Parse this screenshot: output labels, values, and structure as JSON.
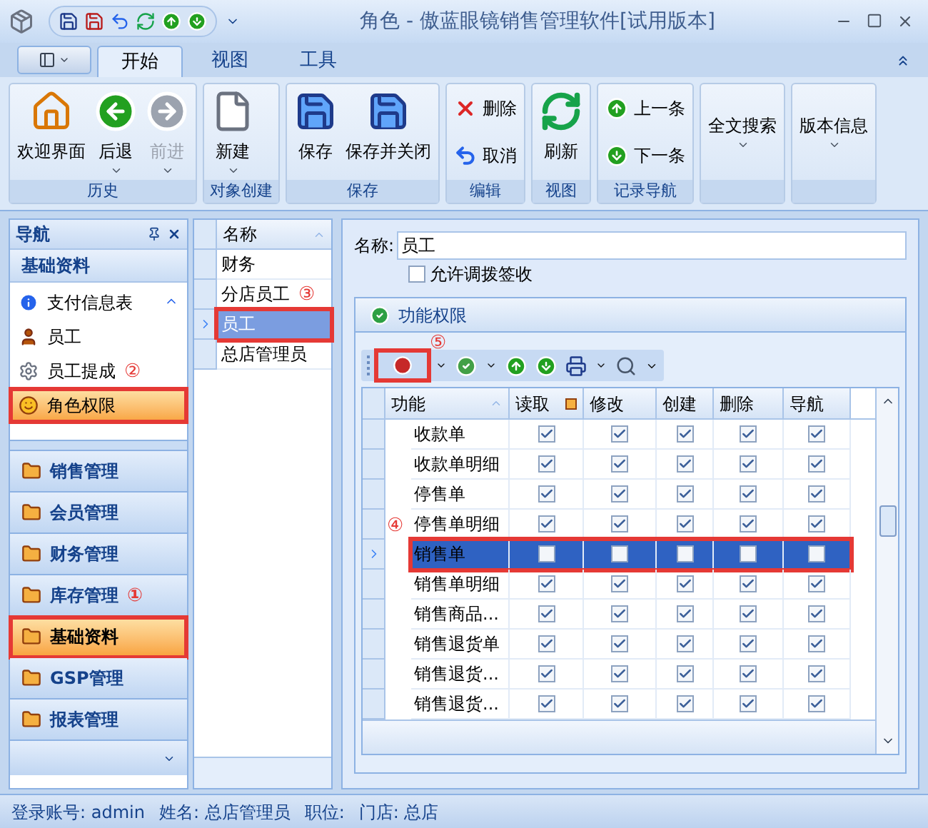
{
  "window": {
    "title": "角色 - 傲蓝眼镜销售管理软件[试用版本]"
  },
  "tabs": [
    {
      "label": "开始",
      "selected": true
    },
    {
      "label": "视图",
      "selected": false
    },
    {
      "label": "工具",
      "selected": false
    }
  ],
  "ribbon": [
    {
      "label": "历史",
      "items": [
        {
          "label": "欢迎界面",
          "kind": "welcome",
          "disabled": false,
          "dropdown": false
        },
        {
          "label": "后退",
          "kind": "back",
          "disabled": false,
          "dropdown": true
        },
        {
          "label": "前进",
          "kind": "forward",
          "disabled": true,
          "dropdown": true
        }
      ]
    },
    {
      "label": "对象创建",
      "items": [
        {
          "label": "新建",
          "kind": "new",
          "disabled": false,
          "dropdown": true
        }
      ]
    },
    {
      "label": "保存",
      "items": [
        {
          "label": "保存",
          "kind": "save",
          "disabled": false,
          "dropdown": false
        },
        {
          "label": "保存并关闭",
          "kind": "saveclose",
          "disabled": false,
          "dropdown": false
        }
      ]
    },
    {
      "label": "编辑",
      "items": [
        {
          "label": "删除",
          "kind": "delete",
          "disabled": false,
          "dropdown": false
        },
        {
          "label": "取消",
          "kind": "undo",
          "disabled": false,
          "dropdown": false
        }
      ]
    },
    {
      "label": "视图",
      "items": [
        {
          "label": "刷新",
          "kind": "refresh",
          "disabled": false,
          "dropdown": false
        }
      ]
    },
    {
      "label": "记录导航",
      "items": [
        {
          "label": "上一条",
          "kind": "up",
          "disabled": false,
          "dropdown": false
        },
        {
          "label": "下一条",
          "kind": "down",
          "disabled": false,
          "dropdown": false
        }
      ]
    },
    {
      "items": [
        {
          "label": "全文搜索",
          "kind": "text",
          "disabled": false,
          "dropdown": true
        }
      ]
    },
    {
      "items": [
        {
          "label": "版本信息",
          "kind": "text",
          "disabled": false,
          "dropdown": true
        }
      ]
    }
  ],
  "navigation": {
    "title": "导航",
    "section": "基础资料",
    "items": [
      {
        "label": "支付信息表",
        "kind": "info",
        "selected": false,
        "highlighted": false
      },
      {
        "label": "员工",
        "kind": "user",
        "selected": false,
        "highlighted": false
      },
      {
        "label": "员工提成",
        "kind": "gear",
        "selected": false,
        "highlighted": false,
        "annotation": "②"
      },
      {
        "label": "角色权限",
        "kind": "mask",
        "selected": true,
        "highlighted": true
      }
    ],
    "categories": [
      {
        "label": "销售管理",
        "selected": false,
        "highlighted": false
      },
      {
        "label": "会员管理",
        "selected": false,
        "highlighted": false
      },
      {
        "label": "财务管理",
        "selected": false,
        "highlighted": false
      },
      {
        "label": "库存管理",
        "selected": false,
        "highlighted": false,
        "annotation": "①"
      },
      {
        "label": "基础资料",
        "selected": true,
        "highlighted": true
      },
      {
        "label": "GSP管理",
        "selected": false,
        "highlighted": false
      },
      {
        "label": "报表管理",
        "selected": false,
        "highlighted": false
      }
    ]
  },
  "role_list": {
    "column": "名称",
    "rows": [
      {
        "name": "财务",
        "selected": false,
        "highlighted": false
      },
      {
        "name": "分店员工",
        "selected": false,
        "highlighted": false,
        "annotation": "③"
      },
      {
        "name": "员工",
        "selected": true,
        "highlighted": true
      },
      {
        "name": "总店管理员",
        "selected": false,
        "highlighted": false
      }
    ]
  },
  "form": {
    "name_label": "名称:",
    "name_value": "员工",
    "checkbox": {
      "label": "允许调拨签收",
      "checked": false
    }
  },
  "permissions": {
    "title": "功能权限",
    "toolbar_annotation": "⑤",
    "grid_annotation": "④",
    "columns": [
      "功能",
      "读取",
      "修改",
      "创建",
      "删除",
      "导航"
    ],
    "rows": [
      {
        "function": "收款单",
        "selected": false,
        "perms": [
          true,
          true,
          true,
          true,
          true
        ]
      },
      {
        "function": "收款单明细",
        "selected": false,
        "perms": [
          true,
          true,
          true,
          true,
          true
        ]
      },
      {
        "function": "停售单",
        "selected": false,
        "perms": [
          true,
          true,
          true,
          true,
          true
        ]
      },
      {
        "function": "停售单明细",
        "selected": false,
        "perms": [
          true,
          true,
          true,
          true,
          true
        ]
      },
      {
        "function": "销售单",
        "selected": true,
        "perms": [
          false,
          false,
          false,
          false,
          false
        ]
      },
      {
        "function": "销售单明细",
        "selected": false,
        "perms": [
          true,
          true,
          true,
          true,
          true
        ]
      },
      {
        "function": "销售商品...",
        "selected": false,
        "perms": [
          true,
          true,
          true,
          true,
          true
        ]
      },
      {
        "function": "销售退货单",
        "selected": false,
        "perms": [
          true,
          true,
          true,
          true,
          true
        ]
      },
      {
        "function": "销售退货...",
        "selected": false,
        "perms": [
          true,
          true,
          true,
          true,
          true
        ]
      },
      {
        "function": "销售退货...",
        "selected": false,
        "perms": [
          true,
          true,
          true,
          true,
          true
        ]
      }
    ]
  },
  "status_bar": [
    "登录账号: admin",
    "姓名: 总店管理员",
    "职位:",
    "门店: 总店"
  ]
}
